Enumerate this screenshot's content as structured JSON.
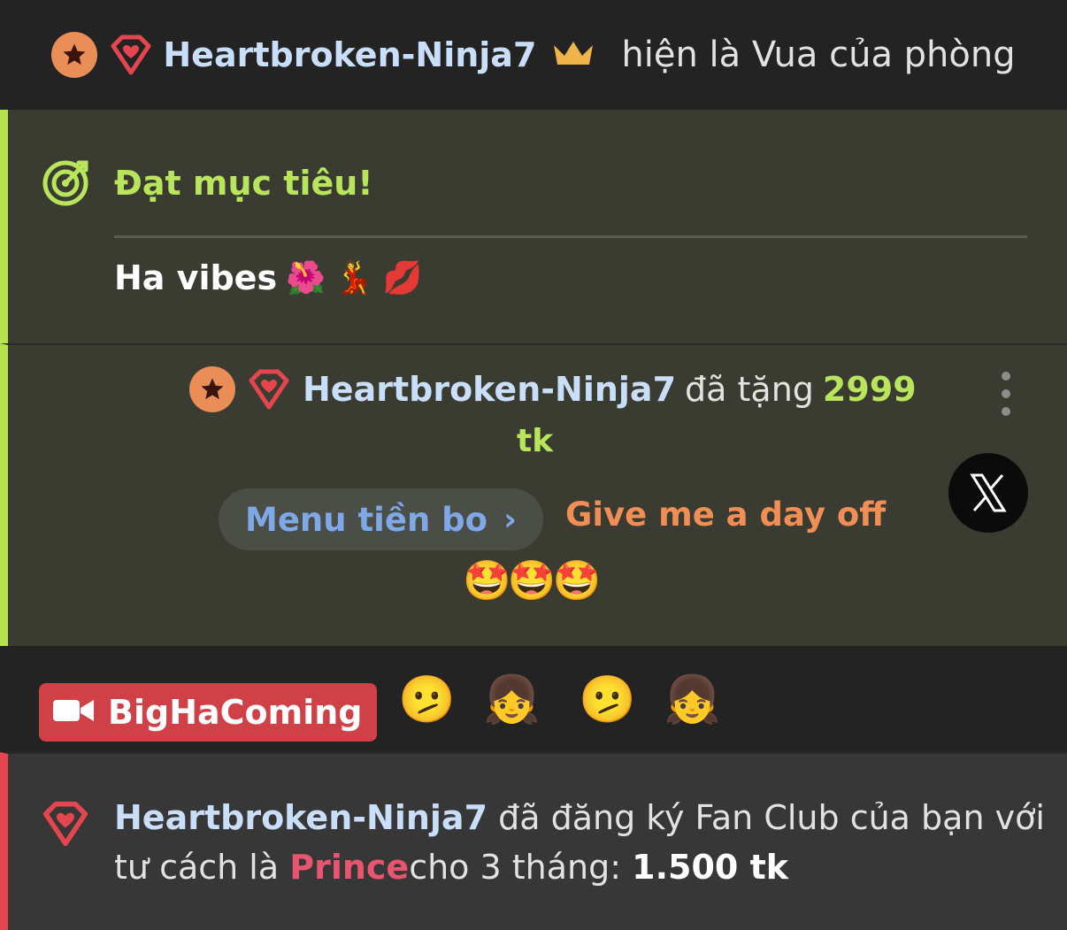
{
  "king": {
    "username": "Heartbroken-Ninja7",
    "text": "hiện là Vua của phòng",
    "icons": [
      "star-badge",
      "heart-badge",
      "crown-icon"
    ]
  },
  "goal": {
    "title": "Đạt mục tiêu!",
    "message": "Ha vibes",
    "emojis": [
      "🌺",
      "💃",
      "💋"
    ],
    "accent": "#b6e44f"
  },
  "tip": {
    "username": "Heartbroken-Ninja7",
    "gave_text": "đã tặng",
    "amount": "2999",
    "unit": "tk",
    "menu_label": "Menu tiền bo",
    "menu_chevron": "›",
    "note": "Give me a day off",
    "emojis": "🤩🤩🤩"
  },
  "stream": {
    "label": "BigHaComing",
    "faces": [
      "🫤",
      "👧",
      "🫤",
      "👧"
    ],
    "badge_color": "#cf4047"
  },
  "fan_club": {
    "username": "Heartbroken-Ninja7",
    "text1": "đã đăng ký Fan Club của bạn với tư cách là",
    "rank": "Prince",
    "text2": "cho 3 tháng:",
    "price": "1.500 tk",
    "accent": "#e5454f"
  }
}
